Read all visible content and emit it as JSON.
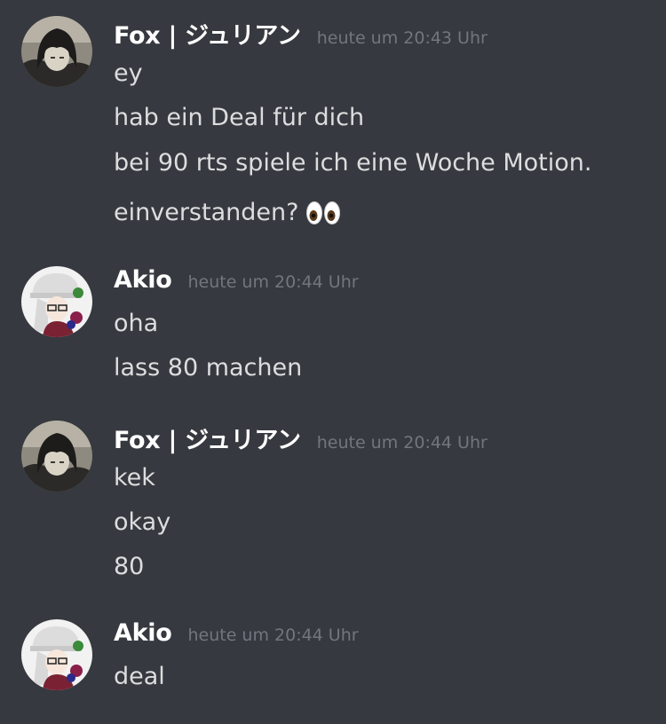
{
  "messages": [
    {
      "author": "Fox | ジュリアン",
      "timestamp": "heute um 20:43 Uhr",
      "avatar_icon": "fox-avatar",
      "lines": [
        "ey",
        "hab ein Deal für dich",
        "bei 90 rts spiele ich eine Woche Motion.",
        "einverstanden?"
      ],
      "emoji": "eyes-emoji"
    },
    {
      "author": "Akio",
      "timestamp": "heute um 20:44 Uhr",
      "avatar_icon": "akio-avatar",
      "lines": [
        "oha",
        "lass 80 machen"
      ]
    },
    {
      "author": "Fox | ジュリアン",
      "timestamp": "heute um 20:44 Uhr",
      "avatar_icon": "fox-avatar",
      "lines": [
        "kek",
        "okay",
        "80"
      ]
    },
    {
      "author": "Akio",
      "timestamp": "heute um 20:44 Uhr",
      "avatar_icon": "akio-avatar",
      "lines": [
        "deal"
      ]
    }
  ],
  "colors": {
    "background": "#36393f",
    "username": "#ffffff",
    "timestamp": "#72767d",
    "message_text": "#dcddde"
  }
}
